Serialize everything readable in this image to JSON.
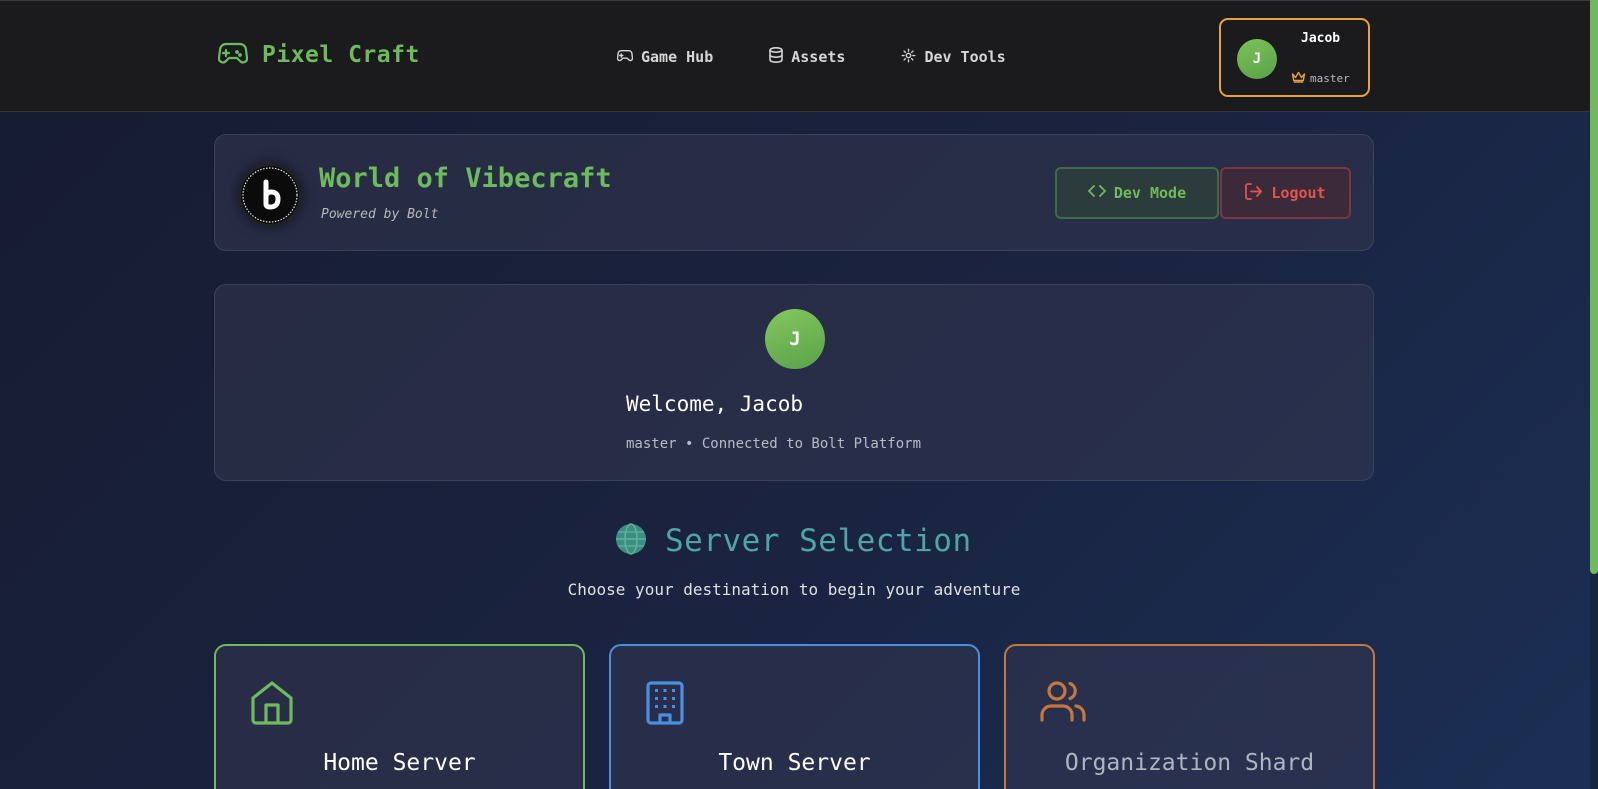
{
  "nav": {
    "brand": "Pixel Craft",
    "items": [
      {
        "label": "Game Hub",
        "icon": "gamepad-icon"
      },
      {
        "label": "Assets",
        "icon": "database-icon"
      },
      {
        "label": "Dev Tools",
        "icon": "gear-icon"
      }
    ],
    "user": {
      "initial": "J",
      "name": "Jacob",
      "role": "master",
      "role_icon": "crown-icon"
    }
  },
  "header": {
    "title": "World of Vibecraft",
    "subtitle": "Powered by Bolt",
    "logo_icon": "bolt-logo-icon",
    "dev_mode_label": "Dev Mode",
    "logout_label": "Logout"
  },
  "welcome": {
    "initial": "J",
    "greeting": "Welcome, Jacob",
    "status": "master • Connected to Bolt Platform"
  },
  "servers": {
    "title": "Server Selection",
    "subtitle": "Choose your destination to begin your adventure",
    "cards": [
      {
        "name": "Home Server",
        "icon": "home-icon"
      },
      {
        "name": "Town Server",
        "icon": "building-icon"
      },
      {
        "name": "Organization Shard",
        "icon": "users-icon"
      }
    ]
  },
  "colors": {
    "accent_green": "#6dbb5b",
    "accent_blue": "#4a90e2",
    "accent_orange": "#c8773c",
    "accent_gold": "#e6a23c",
    "danger": "#e2544c",
    "teal": "#4ea5a3"
  }
}
